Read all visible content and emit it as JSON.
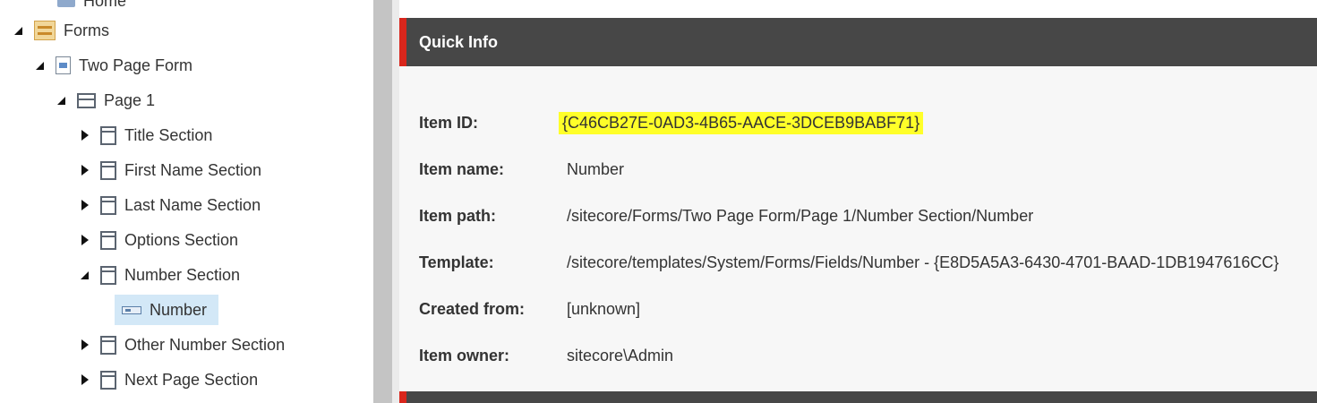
{
  "tree": {
    "home": "Home",
    "forms": "Forms",
    "two_page_form": "Two Page Form",
    "page1": "Page 1",
    "sections": [
      "Title Section",
      "First Name Section",
      "Last Name Section",
      "Options Section",
      "Number Section",
      "Other Number Section",
      "Next Page Section"
    ],
    "number": "Number"
  },
  "quick_info": {
    "title": "Quick Info",
    "fields": [
      {
        "label": "Item ID:",
        "value": "{C46CB27E-0AD3-4B65-AACE-3DCEB9BABF71}"
      },
      {
        "label": "Item name:",
        "value": "Number"
      },
      {
        "label": "Item path:",
        "value": "/sitecore/Forms/Two Page Form/Page 1/Number Section/Number"
      },
      {
        "label": "Template:",
        "value": "/sitecore/templates/System/Forms/Fields/Number - {E8D5A5A3-6430-4701-BAAD-1DB1947616CC}"
      },
      {
        "label": "Created from:",
        "value": "[unknown]"
      },
      {
        "label": "Item owner:",
        "value": "sitecore\\Admin"
      }
    ]
  },
  "colors": {
    "header_bg": "#474747",
    "accent_red": "#d9261c",
    "highlight": "#ffff29",
    "selected_bg": "#d3e8f7"
  }
}
